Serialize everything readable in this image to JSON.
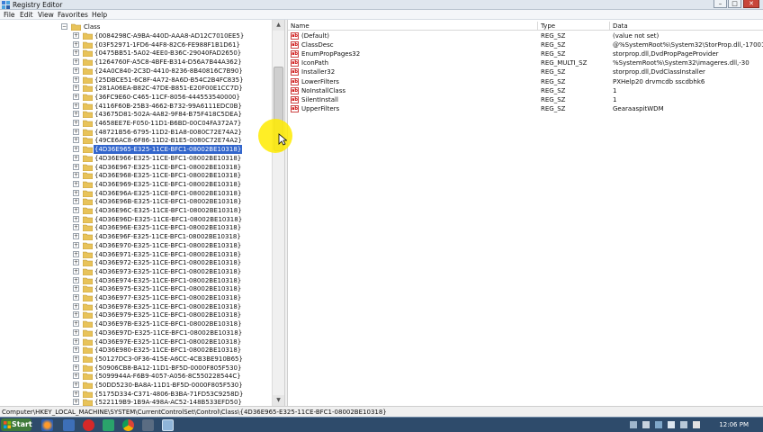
{
  "window": {
    "title": "Registry Editor",
    "buttons": {
      "minimize": "–",
      "maximize": "□",
      "close": "✕"
    }
  },
  "menu": [
    "File",
    "Edit",
    "View",
    "Favorites",
    "Help"
  ],
  "tree": {
    "root_label": "Class",
    "selected_index": 13,
    "items": [
      "{0084298C-A9BA-440D-AAA8-AD12C7010EE5}",
      "{03F52971-1FD6-44F8-82C6-FE988F1B1D61}",
      "{0475BB51-5A02-4EE0-B36C-29040FAD2650}",
      "{1264760F-A5C8-4BFE-B314-D56A7B44A362}",
      "{24A0C840-2C3D-4410-8236-8B40816C7B90}",
      "{25DBCE51-6C8F-4A72-8A6D-B54C2B4FC835}",
      "{281A06EA-B82C-47DE-B851-E20F00E1CC7D}",
      "{36FC9E60-C465-11CF-8056-444553540000}",
      "{4116F60B-25B3-4662-B732-99A6111EDC0B}",
      "{43675D81-502A-4A82-9F84-B75F418C5DEA}",
      "{4658EE7E-F050-11D1-B6BD-00C04FA372A7}",
      "{48721B56-6795-11D2-B1A8-0080C72E74A2}",
      "{49CE6AC8-6F86-11D2-B1E5-0080C72E74A2}",
      "{4D36E965-E325-11CE-BFC1-08002BE10318}",
      "{4D36E966-E325-11CE-BFC1-08002BE10318}",
      "{4D36E967-E325-11CE-BFC1-08002BE10318}",
      "{4D36E968-E325-11CE-BFC1-08002BE10318}",
      "{4D36E969-E325-11CE-BFC1-08002BE10318}",
      "{4D36E96A-E325-11CE-BFC1-08002BE10318}",
      "{4D36E96B-E325-11CE-BFC1-08002BE10318}",
      "{4D36E96C-E325-11CE-BFC1-08002BE10318}",
      "{4D36E96D-E325-11CE-BFC1-08002BE10318}",
      "{4D36E96E-E325-11CE-BFC1-08002BE10318}",
      "{4D36E96F-E325-11CE-BFC1-08002BE10318}",
      "{4D36E970-E325-11CE-BFC1-08002BE10318}",
      "{4D36E971-E325-11CE-BFC1-08002BE10318}",
      "{4D36E972-E325-11CE-BFC1-08002BE10318}",
      "{4D36E973-E325-11CE-BFC1-08002BE10318}",
      "{4D36E974-E325-11CE-BFC1-08002BE10318}",
      "{4D36E975-E325-11CE-BFC1-08002BE10318}",
      "{4D36E977-E325-11CE-BFC1-08002BE10318}",
      "{4D36E978-E325-11CE-BFC1-08002BE10318}",
      "{4D36E979-E325-11CE-BFC1-08002BE10318}",
      "{4D36E97B-E325-11CE-BFC1-08002BE10318}",
      "{4D36E97D-E325-11CE-BFC1-08002BE10318}",
      "{4D36E97E-E325-11CE-BFC1-08002BE10318}",
      "{4D36E980-E325-11CE-BFC1-08002BE10318}",
      "{50127DC3-0F36-415E-A6CC-4CB3BE910B65}",
      "{50906CB8-BA12-11D1-BF5D-0000F805F530}",
      "{5099944A-F6B9-4057-A056-8C550228544C}",
      "{50DD5230-BA8A-11D1-BF5D-0000F805F530}",
      "{5175D334-C371-4806-B3BA-71FD53C9258D}",
      "{522119B9-1B9A-498A-AC52-148B533EFD50}"
    ]
  },
  "values": {
    "headers": [
      "Name",
      "Type",
      "Data"
    ],
    "rows": [
      {
        "name": "(Default)",
        "type": "REG_SZ",
        "data": "(value not set)"
      },
      {
        "name": "ClassDesc",
        "type": "REG_SZ",
        "data": "@%SystemRoot%\\System32\\StorProp.dll,-17001"
      },
      {
        "name": "EnumPropPages32",
        "type": "REG_SZ",
        "data": "storprop.dll,DvdPropPageProvider"
      },
      {
        "name": "IconPath",
        "type": "REG_MULTI_SZ",
        "data": "%SystemRoot%\\System32\\imageres.dll,-30"
      },
      {
        "name": "Installer32",
        "type": "REG_SZ",
        "data": "storprop.dll,DvdClassInstaller"
      },
      {
        "name": "LowerFilters",
        "type": "REG_SZ",
        "data": "PXHelp20 drvmcdb sscdbhk6"
      },
      {
        "name": "NoInstallClass",
        "type": "REG_SZ",
        "data": "1"
      },
      {
        "name": "SilentInstall",
        "type": "REG_SZ",
        "data": "1"
      },
      {
        "name": "UpperFilters",
        "type": "REG_SZ",
        "data": "GearaaspitWDM"
      }
    ]
  },
  "status": {
    "path": "Computer\\HKEY_LOCAL_MACHINE\\SYSTEM\\CurrentControlSet\\Control\\Class\\{4D36E965-E325-11CE-BFC1-08002BE10318}"
  },
  "taskbar": {
    "start_label": "Start",
    "clock": "12:06 PM"
  },
  "icons": {
    "app": "registry-icon",
    "folder": "folder-icon",
    "value": "string-value-icon",
    "start": "windows-flag-icon"
  },
  "colors": {
    "selection": "#3366cc",
    "folder": "#e8c35a",
    "taskbar": "#2e4b6b",
    "highlight": "#ffeb00"
  }
}
